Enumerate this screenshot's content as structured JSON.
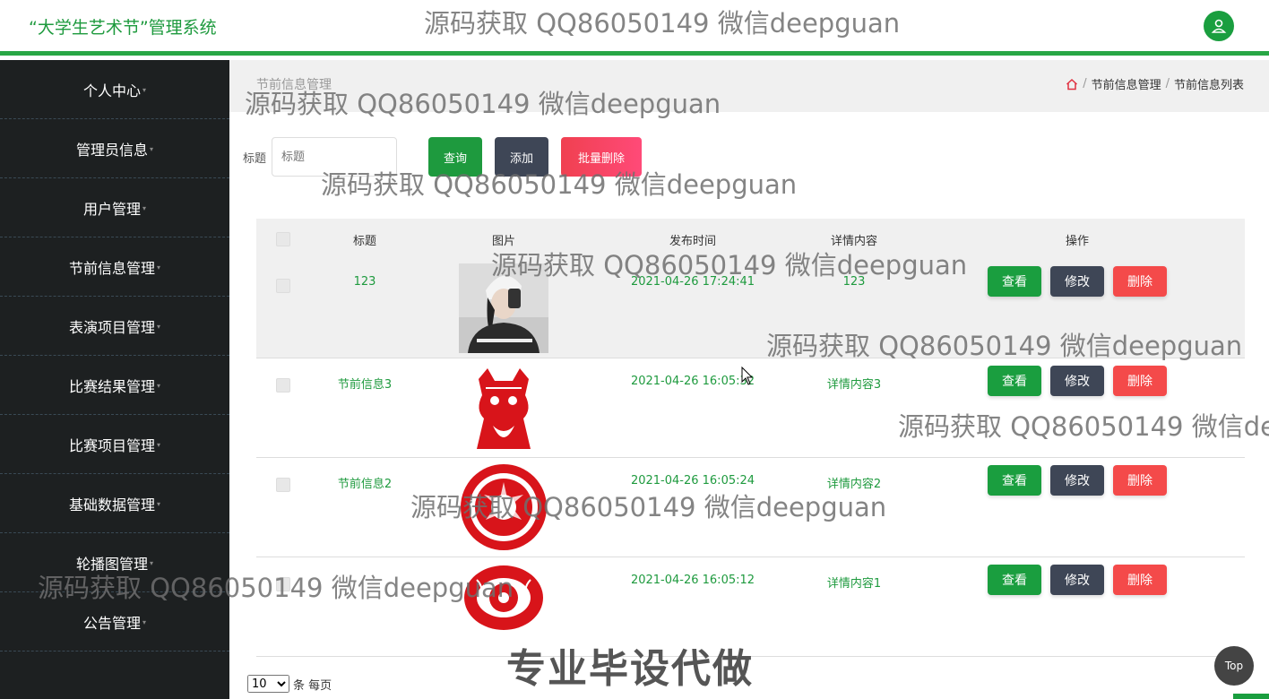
{
  "app": {
    "title": "“大学生艺术节”管理系统"
  },
  "sidebar": {
    "items": [
      {
        "label": "个人中心"
      },
      {
        "label": "管理员信息"
      },
      {
        "label": "用户管理"
      },
      {
        "label": "节前信息管理"
      },
      {
        "label": "表演项目管理"
      },
      {
        "label": "比赛结果管理"
      },
      {
        "label": "比赛项目管理"
      },
      {
        "label": "基础数据管理"
      },
      {
        "label": "轮播图管理"
      },
      {
        "label": "公告管理"
      }
    ]
  },
  "page": {
    "title": "节前信息管理",
    "breadcrumb": [
      "节前信息管理",
      "节前信息列表"
    ]
  },
  "search": {
    "label": "标题",
    "placeholder": "标题"
  },
  "toolbar": {
    "query_label": "查询",
    "add_label": "添加",
    "batch_delete_label": "批量删除"
  },
  "table": {
    "headers": [
      "标题",
      "图片",
      "发布时间",
      "详情内容",
      "操作"
    ],
    "rows": [
      {
        "title": "123",
        "time": "2021-04-26 17:24:41",
        "detail": "123"
      },
      {
        "title": "节前信息3",
        "time": "2021-04-26 16:05:32",
        "detail": "详情内容3"
      },
      {
        "title": "节前信息2",
        "time": "2021-04-26 16:05:24",
        "detail": "详情内容2"
      },
      {
        "title": "",
        "time": "2021-04-26 16:05:12",
        "detail": "详情内容1"
      }
    ],
    "actions": {
      "view": "查看",
      "edit": "修改",
      "delete": "删除"
    }
  },
  "pagination": {
    "page_size": "10",
    "suffix": "条 每页"
  },
  "watermark": {
    "text": "源码获取 QQ86050149 微信deepguan",
    "promo": "专业毕设代做"
  },
  "top_button": {
    "label": "Top"
  },
  "colors": {
    "brand": "#1e9a3e",
    "view": "#1a9e3f",
    "edit": "#3e4656",
    "delete": "#f44a4a",
    "query": "#1e9a3e",
    "add": "#3e4656",
    "batch_delete": "#f04050"
  }
}
